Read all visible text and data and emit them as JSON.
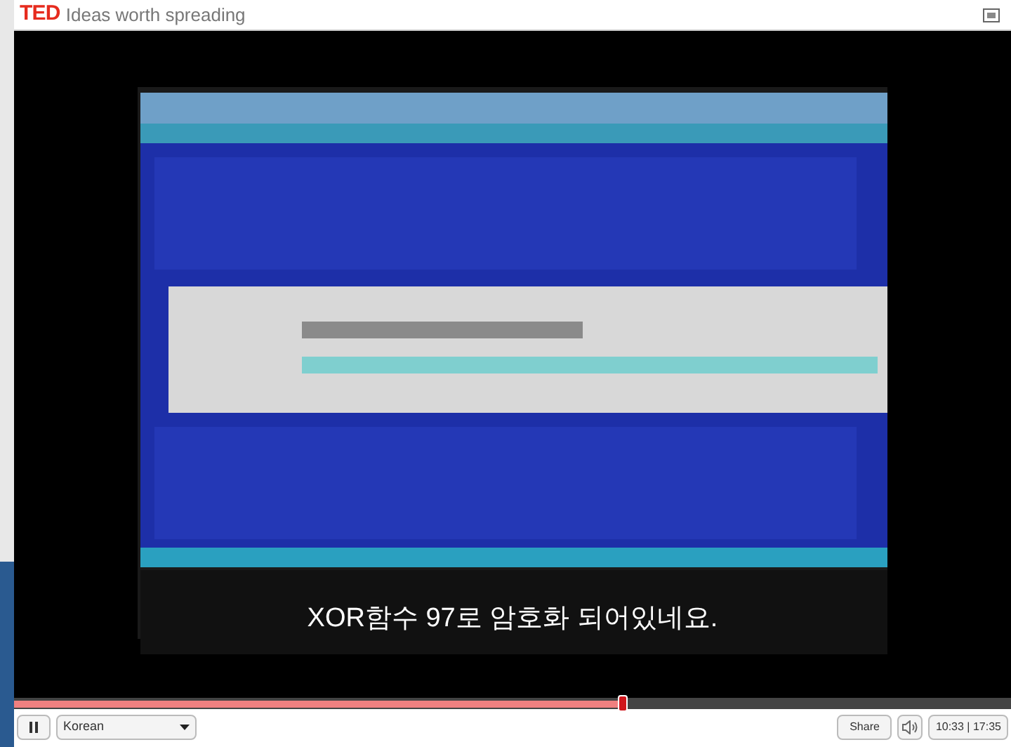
{
  "header": {
    "logo": "TED",
    "tagline": "Ideas worth spreading"
  },
  "video": {
    "subtitle": "XOR함수 97로 암호화 되어있네요."
  },
  "progress": {
    "level": 0.61
  },
  "controls": {
    "playing": true,
    "language": "Korean",
    "share": "Share",
    "time": "10:33 | 17:35"
  }
}
